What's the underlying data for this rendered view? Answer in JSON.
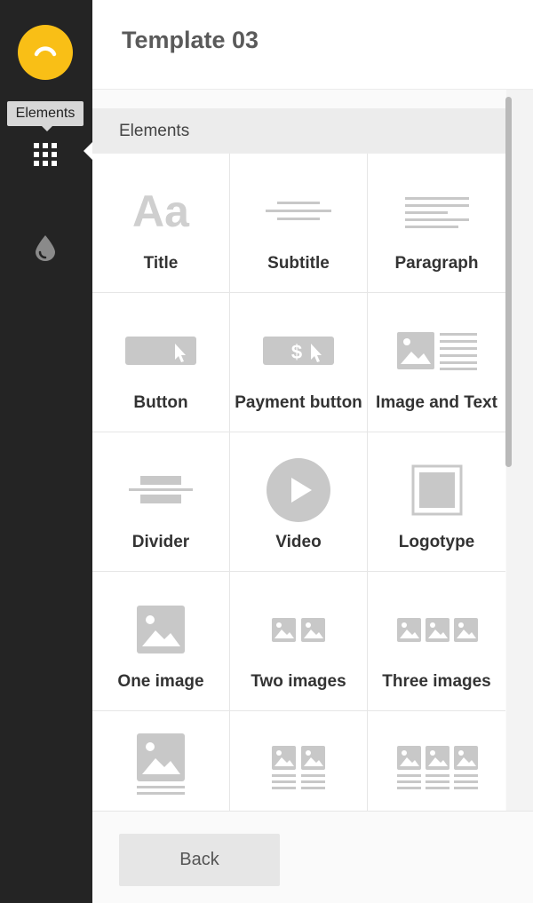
{
  "header": {
    "title": "Template 03"
  },
  "sidebar": {
    "tooltip": "Elements",
    "items": [
      {
        "name": "elements",
        "icon": "grid-icon",
        "active": true
      },
      {
        "name": "styles",
        "icon": "drop-icon",
        "active": false
      }
    ]
  },
  "panel": {
    "section_title": "Elements",
    "tiles": [
      {
        "label": "Title",
        "icon": "title-icon"
      },
      {
        "label": "Subtitle",
        "icon": "subtitle-icon"
      },
      {
        "label": "Paragraph",
        "icon": "paragraph-icon"
      },
      {
        "label": "Button",
        "icon": "button-icon"
      },
      {
        "label": "Payment button",
        "icon": "payment-button-icon"
      },
      {
        "label": "Image and Text",
        "icon": "image-and-text-icon"
      },
      {
        "label": "Divider",
        "icon": "divider-icon"
      },
      {
        "label": "Video",
        "icon": "video-icon"
      },
      {
        "label": "Logotype",
        "icon": "logotype-icon"
      },
      {
        "label": "One image",
        "icon": "one-image-icon"
      },
      {
        "label": "Two images",
        "icon": "two-images-icon"
      },
      {
        "label": "Three images",
        "icon": "three-images-icon"
      },
      {
        "label": "",
        "icon": "image-with-caption-icon"
      },
      {
        "label": "",
        "icon": "two-images-with-caption-icon"
      },
      {
        "label": "",
        "icon": "three-images-with-caption-icon"
      }
    ]
  },
  "footer": {
    "back_label": "Back"
  },
  "colors": {
    "sidebar_bg": "#242424",
    "brand_yellow": "#f9bf16",
    "icon_grey": "#c8c8c8",
    "title_grey": "#5a5a5a"
  }
}
